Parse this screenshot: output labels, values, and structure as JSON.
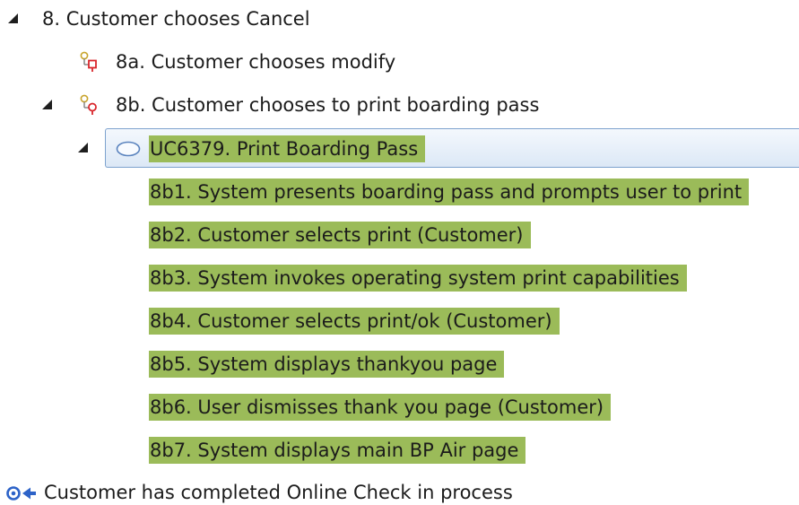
{
  "tree": {
    "item_8": {
      "label": "8. Customer chooses Cancel",
      "expanded": true,
      "icon": "collapse-triangle"
    },
    "item_8a": {
      "label": "8a. Customer chooses modify",
      "icon": "alternate-flow-icon"
    },
    "item_8b": {
      "label": "8b. Customer chooses to print boarding pass",
      "expanded": true,
      "icon": "alternate-flow-icon"
    },
    "use_case": {
      "label": "UC6379. Print Boarding Pass",
      "expanded": true,
      "selected": true,
      "icon": "use-case-ellipse-icon"
    },
    "steps": [
      {
        "label": "8b1. System presents boarding pass and prompts user to print"
      },
      {
        "label": "8b2. Customer selects print (Customer)"
      },
      {
        "label": "8b3. System invokes operating system print capabilities"
      },
      {
        "label": "8b4. Customer selects print/ok (Customer)"
      },
      {
        "label": "8b5. System displays thankyou page"
      },
      {
        "label": "8b6. User dismisses thank you page (Customer)"
      },
      {
        "label": "8b7. System displays main BP Air page"
      }
    ],
    "postcondition": {
      "label": "Customer has completed Online Check in process",
      "icon": "postcondition-icon"
    }
  },
  "colors": {
    "highlight": "#9bbb59",
    "selection_border": "#7da2ce",
    "selection_bg": "#dce8f6",
    "flow_icon_red": "#d9262c",
    "flow_icon_gold": "#c8a42c",
    "postcondition_blue": "#2d63c8"
  }
}
